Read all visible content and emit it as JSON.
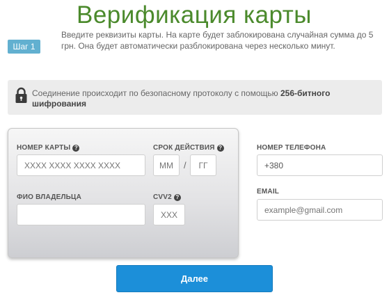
{
  "header": {
    "title": "Верификация карты"
  },
  "step": {
    "badge": "Шаг 1",
    "description": "Введите реквизиты карты. На карте будет заблокирована случайная сумма до 5 грн. Она будет автоматически разблокирована через несколько минут."
  },
  "security": {
    "text_prefix": "Соединение происходит по безопасному протоколу с помощью ",
    "text_bold": "256-битного шифрования",
    "icon": "lock-icon"
  },
  "card_form": {
    "card_number": {
      "label": "НОМЕР КАРТЫ",
      "placeholder": "XXXX XXXX XXXX XXXX"
    },
    "expiry": {
      "label": "СРОК ДЕЙСТВИЯ",
      "month_placeholder": "ММ",
      "separator": "/",
      "year_placeholder": "ГГ"
    },
    "holder": {
      "label": "ФИО ВЛАДЕЛЬЦА",
      "placeholder": ""
    },
    "cvv": {
      "label": "CVV2",
      "placeholder": "XXX"
    },
    "help_icon": "?"
  },
  "contact": {
    "phone": {
      "label": "НОМЕР ТЕЛЕФОНА",
      "value": "+380"
    },
    "email": {
      "label": "EMAIL",
      "placeholder": "example@gmail.com"
    }
  },
  "actions": {
    "next_label": "Далее"
  },
  "colors": {
    "title_green": "#4b8a2c",
    "badge_blue": "#62b0d0",
    "button_blue": "#1c8fd9"
  }
}
